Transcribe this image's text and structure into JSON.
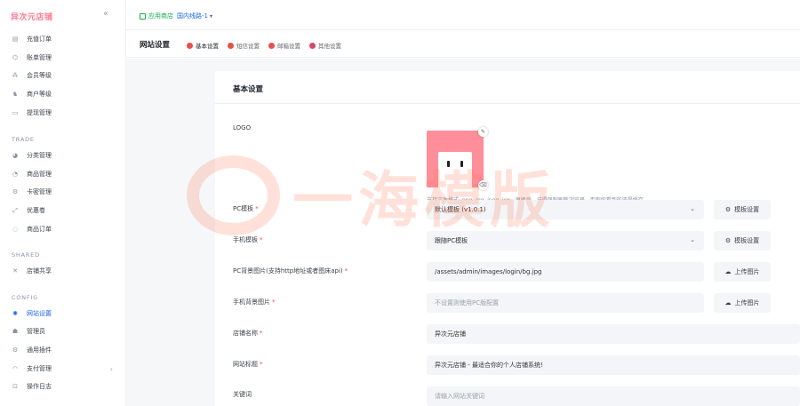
{
  "app": {
    "logo": "异次元店铺",
    "collapse_icon": "double-chevron-left-icon"
  },
  "sidebar": {
    "items_top": [
      {
        "label": "充值订单",
        "icon": "order-icon"
      },
      {
        "label": "账单管理",
        "icon": "bill-icon"
      },
      {
        "label": "会员等级",
        "icon": "member-icon"
      },
      {
        "label": "商户等级",
        "icon": "merchant-icon"
      },
      {
        "label": "提现管理",
        "icon": "withdraw-icon"
      }
    ],
    "section_trade": "TRADE",
    "items_trade": [
      {
        "label": "分类管理",
        "icon": "category-icon"
      },
      {
        "label": "商品管理",
        "icon": "goods-icon"
      },
      {
        "label": "卡密管理",
        "icon": "card-icon"
      },
      {
        "label": "优惠卷",
        "icon": "coupon-icon"
      },
      {
        "label": "商品订单",
        "icon": "goods-order-icon"
      }
    ],
    "section_shared": "SHARED",
    "items_shared": [
      {
        "label": "店铺共享",
        "icon": "share-icon"
      }
    ],
    "section_config": "CONFIG",
    "items_config": [
      {
        "label": "网站设置",
        "icon": "gear-icon",
        "active": true
      },
      {
        "label": "管理员",
        "icon": "admin-icon"
      },
      {
        "label": "通用插件",
        "icon": "plugin-icon"
      },
      {
        "label": "支付管理",
        "icon": "payment-icon",
        "arrow": "›"
      },
      {
        "label": "操作日志",
        "icon": "log-icon"
      }
    ]
  },
  "topbar": {
    "app_store": "应用商店",
    "line": "国内线路-1",
    "dropdown": "▾"
  },
  "header": {
    "title": "网站设置",
    "tabs": [
      {
        "label": "基本设置",
        "active": true,
        "color": "#e8504a"
      },
      {
        "label": "短信设置",
        "color": "#e8504a"
      },
      {
        "label": "邮箱设置",
        "color": "#e8504a"
      },
      {
        "label": "其他设置",
        "color": "#d04a6a"
      }
    ]
  },
  "form": {
    "section_title": "基本设置",
    "logo_label": "LOGO",
    "logo_hint": "支持文件格式: png, jpg, jpeg, ico。更换后，记得强制刷新浏览器，否则你看到的还是缓存。",
    "pc_template_label": "PC模板",
    "pc_template_value": "默认模板 (v1.0.1)",
    "mobile_template_label": "手机模板",
    "mobile_template_value": "跟随PC模板",
    "template_settings_label": "模板设置",
    "pc_bg_label": "PC背景图片(支持http地址或者图床api)",
    "pc_bg_value": "/assets/admin/images/login/bg.jpg",
    "upload_label": "上传图片",
    "mobile_bg_label": "手机背景图片",
    "mobile_bg_placeholder": "不设置则使用PC版配置",
    "shop_name_label": "店铺名称",
    "shop_name_value": "异次元店铺",
    "site_title_label": "网站标题",
    "site_title_value": "异次元店铺 - 最适合你的个人店铺系统!",
    "keywords_label": "关键词",
    "keywords_placeholder": "请输入网站关键词",
    "required_mark": "*"
  },
  "watermark": {
    "text": "一海模版"
  }
}
